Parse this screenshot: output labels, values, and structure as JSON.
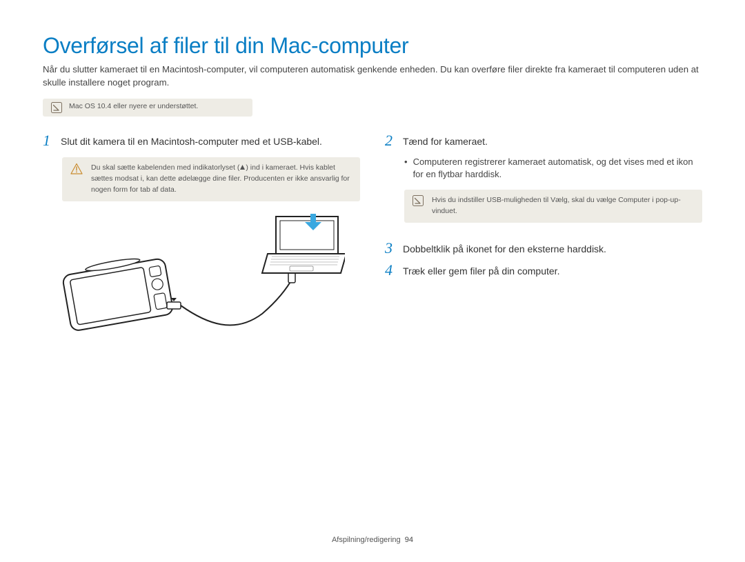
{
  "title": "Overførsel af filer til din Mac-computer",
  "intro": "Når du slutter kameraet til en Macintosh-computer, vil computeren automatisk genkende enheden. Du kan overføre filer direkte fra kameraet til computeren uden at skulle installere noget program.",
  "intro_note": "Mac OS 10.4 eller nyere er understøttet.",
  "steps": {
    "s1": {
      "num": "1",
      "text": "Slut dit kamera til en Macintosh-computer med et USB-kabel.",
      "warn_a": "Du skal sætte kabelenden med indikatorlyset (",
      "warn_b": ") ind i kameraet. Hvis kablet sættes modsat i, kan dette ødelægge dine filer. Producenten er ikke ansvarlig for nogen form for tab af data."
    },
    "s2": {
      "num": "2",
      "text": "Tænd for kameraet.",
      "bullet": "Computeren registrerer kameraet automatisk, og det vises med et ikon for en flytbar harddisk.",
      "note_a": "Hvis du indstiller USB-muligheden til ",
      "note_bold1": "Vælg",
      "note_b": ", skal du vælge ",
      "note_bold2": "Computer",
      "note_c": " i pop-up-vinduet."
    },
    "s3": {
      "num": "3",
      "text": "Dobbeltklik på ikonet for den eksterne harddisk."
    },
    "s4": {
      "num": "4",
      "text": "Træk eller gem filer på din computer."
    }
  },
  "footer": {
    "section": "Afspilning/redigering",
    "page": "94"
  }
}
